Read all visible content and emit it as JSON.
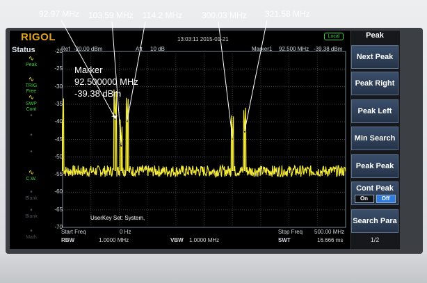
{
  "brand": "RIGOL",
  "datetime": "13:03:11  2015-01-21",
  "local": "Local",
  "ref_label": "Ref",
  "ref_value": "-20.00 dBm",
  "att_label": "Att",
  "att_value": "10 dB",
  "marker_header_label": "Marker1",
  "marker_header_freq": "92.500 MHz",
  "marker_header_amp": "-39.38 dBm",
  "marker_box": {
    "title": "Marker",
    "freq": "92.500000 MHz",
    "amp": "-39.38 dBm"
  },
  "marker_point_label": "1",
  "annotations": [
    "92.97 MHz",
    "103.59 MHz",
    "114.2 MHz",
    "300.03 MHz",
    "321.58 MHz"
  ],
  "status": {
    "title": "Status",
    "items": [
      {
        "icon": "peak-icon",
        "label": "Peak",
        "active": true
      },
      {
        "icon": "trig-icon",
        "label": "TRIG\nFree",
        "active": true
      },
      {
        "icon": "swp-icon",
        "label": "SWP\nCont",
        "active": true
      },
      {
        "icon": "blank-icon",
        "label": "",
        "active": false
      },
      {
        "icon": "blank-icon",
        "label": "",
        "active": false
      },
      {
        "icon": "blank-icon",
        "label": "",
        "active": false
      },
      {
        "icon": "trace-cw-icon",
        "label": "C.W.",
        "active": true
      },
      {
        "icon": "blank-icon",
        "label": "Blank",
        "active": false
      },
      {
        "icon": "blank-icon",
        "label": "Blank",
        "active": false
      },
      {
        "icon": "math-icon",
        "label": "Math",
        "active": false
      }
    ]
  },
  "userkey": "UserKey Set:   System,",
  "footer": {
    "start_freq_label": "Start Freq",
    "start_freq_value": "0 Hz",
    "stop_freq_label": "Stop Freq",
    "stop_freq_value": "500.00 MHz",
    "rbw_label": "RBW",
    "rbw_value": "1.0000 MHz",
    "vbw_label": "VBW",
    "vbw_value": "1.0000 MHz",
    "swt_label": "SWT",
    "swt_value": "16.666 ms"
  },
  "softkeys": {
    "title": "Peak",
    "buttons": [
      "Next Peak",
      "Peak Right",
      "Peak Left",
      "Min Search",
      "Peak Peak"
    ],
    "cont_peak": {
      "label": "Cont Peak",
      "on": "On",
      "off": "Off"
    },
    "search_para": "Search Para",
    "page": "1/2"
  },
  "chart_data": {
    "type": "line",
    "title": "",
    "xlabel": "",
    "ylabel": "",
    "xlim": [
      0,
      500
    ],
    "ylim": [
      -70,
      -20
    ],
    "yticks": [
      -20,
      -25,
      -30,
      -35,
      -40,
      -45,
      -50,
      -55,
      -60,
      -65,
      -70
    ],
    "noise_floor": -54,
    "peaks": [
      {
        "x": 0,
        "y": -40
      },
      {
        "x": 92.97,
        "y": -39.38
      },
      {
        "x": 103.59,
        "y": -47
      },
      {
        "x": 114.2,
        "y": -40
      },
      {
        "x": 300.03,
        "y": -45
      },
      {
        "x": 321.58,
        "y": -43
      }
    ],
    "trace_color": "#f3e93a",
    "grid": true
  }
}
